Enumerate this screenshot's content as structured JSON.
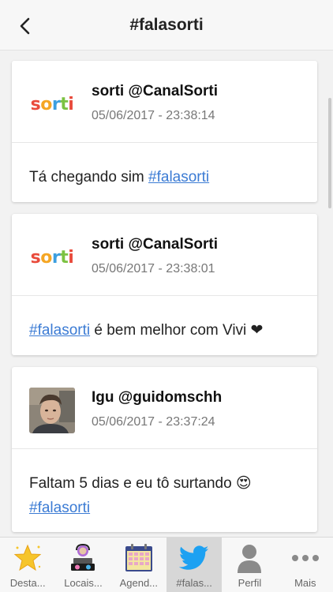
{
  "header": {
    "title": "#falasorti"
  },
  "tweets": [
    {
      "user": "sorti @CanalSorti",
      "time": "05/06/2017 - 23:38:14",
      "text_before": "Tá chegando sim ",
      "hashtag": "#falasorti",
      "text_after": "",
      "avatar": "sorti-logo"
    },
    {
      "user": "sorti @CanalSorti",
      "time": "05/06/2017 - 23:38:01",
      "text_before": "",
      "hashtag": "#falasorti",
      "text_after": " é bem melhor com Vivi ❤",
      "avatar": "sorti-logo"
    },
    {
      "user": "Igu @guidomschh",
      "time": "05/06/2017 - 23:37:24",
      "text_before": "Faltam 5 dias e eu tô surtando 😍 ",
      "hashtag": "#falasorti",
      "text_after": "",
      "avatar": "user-photo"
    }
  ],
  "logo": {
    "letters": [
      "s",
      "o",
      "r",
      "t",
      "i"
    ],
    "colors": [
      "#e94b3c",
      "#f5a623",
      "#3c9fe0",
      "#7cc242",
      "#e94b3c"
    ]
  },
  "tabs": [
    {
      "label": "Desta...",
      "icon": "star-icon"
    },
    {
      "label": "Locais...",
      "icon": "dj-icon"
    },
    {
      "label": "Agend...",
      "icon": "calendar-icon"
    },
    {
      "label": "#falas...",
      "icon": "twitter-bird-icon",
      "active": true
    },
    {
      "label": "Perfil",
      "icon": "person-icon"
    },
    {
      "label": "Mais",
      "icon": "more-dots-icon"
    }
  ],
  "colors": {
    "link": "#3b7bd4",
    "twitter": "#1da1f2",
    "active_tab": "#d7d7d7"
  }
}
